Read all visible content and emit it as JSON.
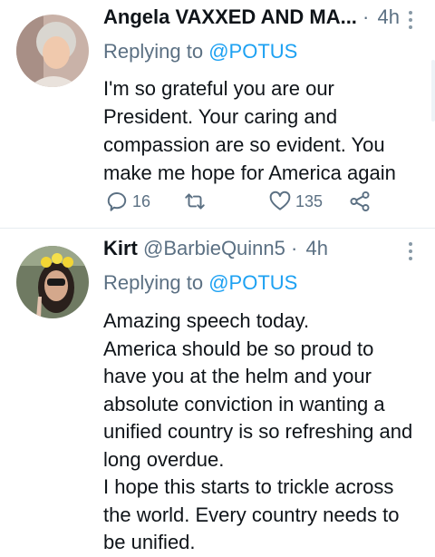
{
  "colors": {
    "accent": "#1da1f2",
    "muted": "#5b7083",
    "text": "#0f1419",
    "divider": "#e6ecf0"
  },
  "tweets": [
    {
      "name": "Angela VAXXED AND MA...",
      "handle": "",
      "dot": "·",
      "time": "4h",
      "reply_prefix": "Replying to",
      "reply_to": "@POTUS",
      "text": [
        "I'm so grateful you are our President. Your caring and compassion are so evident. You make me hope for America again"
      ],
      "reply_count": "16",
      "retweet_count": "",
      "like_count": "135",
      "icons": [
        "reply-icon",
        "retweet-icon",
        "like-icon",
        "share-icon"
      ]
    },
    {
      "name": "Kirt",
      "handle": "@BarbieQuinn5",
      "dot": "·",
      "time": "4h",
      "reply_prefix": "Replying to",
      "reply_to": "@POTUS",
      "text": [
        "Amazing speech today.",
        "America should be so proud to have you at the helm and your absolute conviction in wanting a unified country is so refreshing and long overdue.",
        "I hope this starts to trickle across the world. Every country needs to be unified."
      ]
    }
  ]
}
